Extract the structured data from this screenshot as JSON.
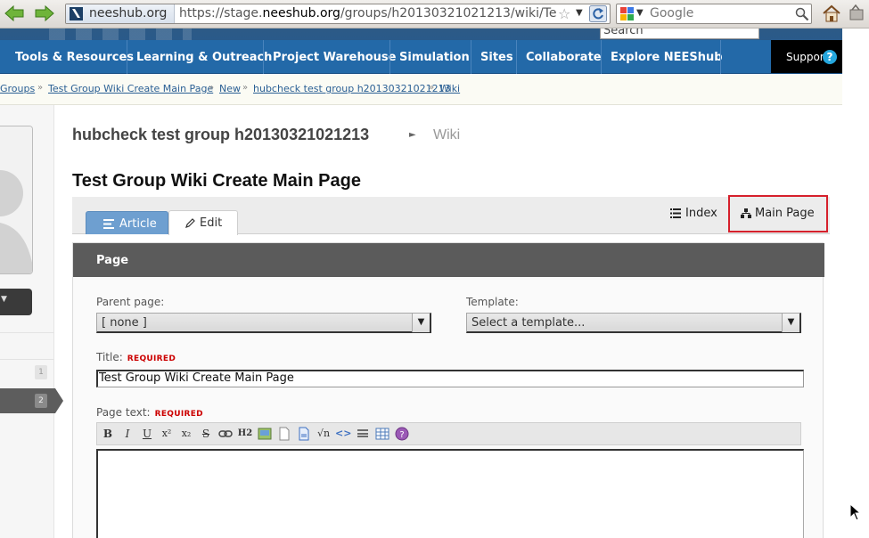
{
  "browser": {
    "site_name": "neeshub.org",
    "url_prefix": "https://stage.",
    "url_domain": "neeshub.org",
    "url_rest": "/groups/h20130321021213/wiki/Te",
    "search_placeholder": "Google",
    "icons": [
      "back-arrow-icon",
      "forward-arrow-icon",
      "site-favicon",
      "star-icon",
      "reload-icon",
      "google-icon",
      "magnifier-icon",
      "home-icon"
    ]
  },
  "header": {
    "search_placeholder": "Search"
  },
  "nav": {
    "items": [
      "Tools & Resources",
      "Learning & Outreach",
      "Project Warehouse",
      "Simulation",
      "Sites",
      "Collaborate",
      "Explore NEEShub"
    ],
    "support": "Support",
    "help": "?"
  },
  "breadcrumb": {
    "items": [
      "Groups",
      "Test Group Wiki Create Main Page",
      "New",
      "hubcheck test group h20130321021213",
      "Wiki"
    ],
    "separator": "»"
  },
  "sidebar": {
    "badges": [
      "1",
      "2"
    ]
  },
  "group": {
    "title": "hubcheck test group h20130321021213",
    "arrow": "►",
    "section": "Wiki"
  },
  "page": {
    "title": "Test Group Wiki Create Main Page"
  },
  "tabs": {
    "article": "Article",
    "edit": "Edit",
    "index": "Index",
    "main_page": "Main Page"
  },
  "form": {
    "panel_title": "Page",
    "parent_label": "Parent page:",
    "parent_value": "[ none ]",
    "template_label": "Template:",
    "template_value": "Select a template...",
    "title_label": "Title:",
    "required": "REQUIRED",
    "title_value": "Test Group Wiki Create Main Page",
    "pagetext_label": "Page text:",
    "editor_text": ""
  },
  "editor_toolbar": {
    "bold": "B",
    "italic": "I",
    "underline": "U",
    "superscript": "x²",
    "subscript": "x₂",
    "strike": "S",
    "heading": "H2",
    "math": "√n",
    "code": "<>"
  },
  "colors": {
    "nav_bg": "#2369a8",
    "article_tab": "#6e9fd0",
    "highlight": "#d6202c",
    "required": "#cc0000"
  }
}
